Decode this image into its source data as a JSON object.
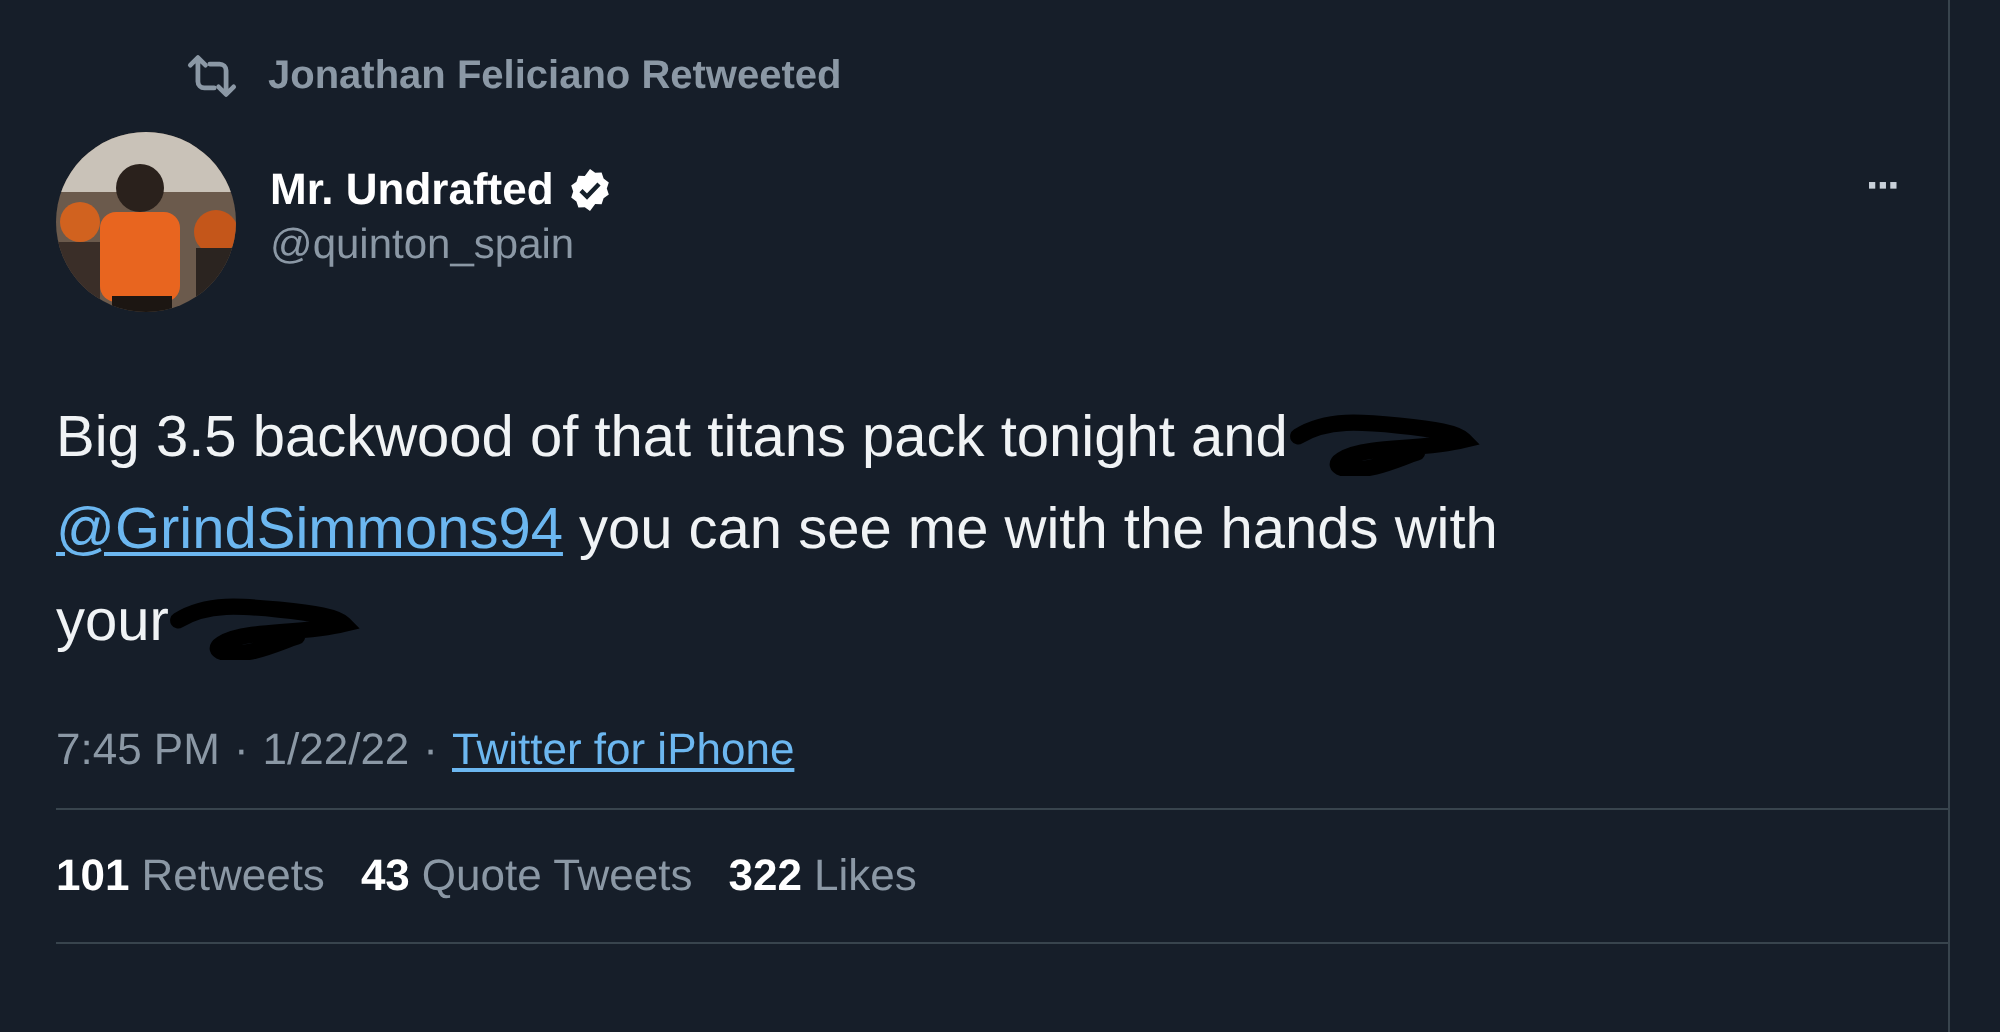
{
  "retweet_banner": {
    "text": "Jonathan Feliciano Retweeted"
  },
  "author": {
    "name": "Mr. Undrafted",
    "verified": true,
    "handle": "@quinton_spain"
  },
  "more_menu": "···",
  "body": [
    {
      "kind": "text",
      "text": "Big 3.5 backwood of that titans pack tonight and"
    },
    {
      "kind": "redaction"
    },
    {
      "kind": "break"
    },
    {
      "kind": "mention",
      "text": "@GrindSimmons94"
    },
    {
      "kind": "text",
      "text": "you can see me with the hands with"
    },
    {
      "kind": "break"
    },
    {
      "kind": "text",
      "text": "your"
    },
    {
      "kind": "redaction"
    }
  ],
  "meta": {
    "time": "7:45 PM",
    "separator": "·",
    "date": "1/22/22",
    "separator_2": "·",
    "source": "Twitter for iPhone"
  },
  "stats": [
    {
      "count": "101",
      "label": "Retweets"
    },
    {
      "count": "43",
      "label": "Quote Tweets"
    },
    {
      "count": "322",
      "label": "Likes"
    }
  ]
}
